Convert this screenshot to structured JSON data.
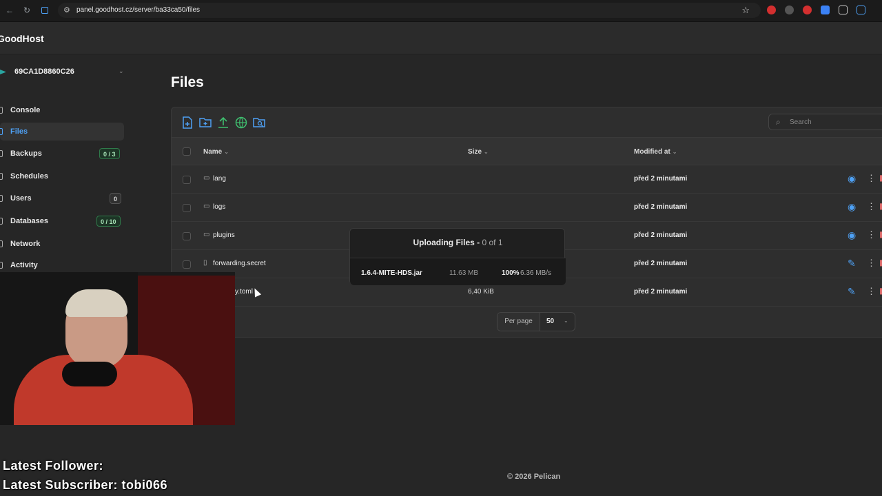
{
  "browser": {
    "back": "←",
    "forward": "→",
    "reload": "↻",
    "url": "panel.goodhost.cz/server/ba33ca50/files",
    "star": "☆"
  },
  "app": {
    "logo": "GoodHost"
  },
  "sidebar": {
    "server_name": "69CA1D8860C26",
    "items": [
      {
        "label": "Console"
      },
      {
        "label": "Files",
        "active": true
      },
      {
        "label": "Backups",
        "badge": "0 / 3"
      },
      {
        "label": "Schedules"
      },
      {
        "label": "Users",
        "badge": "0"
      },
      {
        "label": "Databases",
        "badge": "0 / 10"
      },
      {
        "label": "Network"
      },
      {
        "label": "Activity"
      }
    ]
  },
  "main": {
    "title": "Files",
    "search_placeholder": "Search",
    "columns": {
      "name": "Name",
      "size": "Size",
      "modified": "Modified at"
    },
    "rows": [
      {
        "name": "lang",
        "type": "folder",
        "size": "",
        "modified": "před 2 minutami",
        "action": "eye"
      },
      {
        "name": "logs",
        "type": "folder",
        "size": "",
        "modified": "před 2 minutami",
        "action": "eye"
      },
      {
        "name": "plugins",
        "type": "folder",
        "size": "",
        "modified": "před 2 minutami",
        "action": "eye"
      },
      {
        "name": "forwarding.secret",
        "type": "file",
        "size": "",
        "modified": "před 2 minutami",
        "action": "pencil"
      },
      {
        "name": "y.toml",
        "type": "file",
        "size": "6,40 KiB",
        "modified": "před 2 minutami",
        "action": "pencil"
      }
    ],
    "per_page_label": "Per page",
    "per_page_value": "50",
    "footer": "© 2026 Pelican"
  },
  "upload": {
    "title": "Uploading Files -",
    "progress": "0 of 1",
    "file": "1.6.4-MITE-HDS.jar",
    "size": "11.63 MB",
    "percent": "100%",
    "speed": "6.36 MB/s"
  },
  "stream_overlay": {
    "follower": "Latest Follower:",
    "subscriber": "Latest Subscriber: tobi066"
  },
  "colors": {
    "accent": "#4ea1f5",
    "danger": "#e06c6c",
    "badge_green": "#1d3526"
  }
}
